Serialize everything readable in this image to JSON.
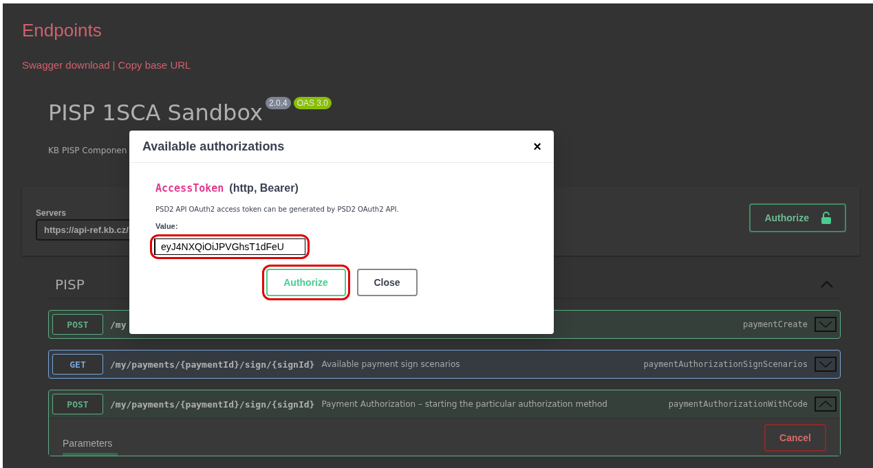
{
  "page": {
    "heading": "Endpoints",
    "links": [
      "Swagger download",
      "Copy base URL"
    ],
    "link_separator": "|"
  },
  "api": {
    "title": "PISP 1SCA Sandbox",
    "version": "2.0.4",
    "spec": "OAS 3.0",
    "description": "KB PISP Componen"
  },
  "servers": {
    "label": "Servers",
    "value": "https://api-ref.kb.cz/"
  },
  "authorize_button": "Authorize",
  "section": {
    "title": "PISP",
    "expanded": true
  },
  "operations": [
    {
      "method": "POST",
      "path": "/my",
      "operation_id": "paymentCreate",
      "expanded": false
    },
    {
      "method": "GET",
      "path": "/my/payments/{paymentId}/sign/{signId}",
      "summary": "Available payment sign scenarios",
      "operation_id": "paymentAuthorizationSignScenarios",
      "expanded": false
    },
    {
      "method": "POST",
      "path": "/my/payments/{paymentId}/sign/{signId}",
      "summary": "Payment Authorization – starting the particular authorization method",
      "operation_id": "paymentAuthorizationWithCode",
      "expanded": true,
      "tab": "Parameters",
      "cancel": "Cancel"
    }
  ],
  "modal": {
    "title": "Available authorizations",
    "close_icon": "×",
    "scheme_name": "AccessToken",
    "scheme_type": "(http, Bearer)",
    "description": "PSD2 API OAuth2 access token can be generated by PSD2 OAuth2 API.",
    "value_label": "Value:",
    "value": "eyJ4NXQiOiJPVGhsT1dFeU",
    "buttons": [
      {
        "label": "Authorize",
        "kind": "primary",
        "highlighted": true
      },
      {
        "label": "Close",
        "kind": "secondary",
        "highlighted": false
      }
    ],
    "input_highlighted": true
  }
}
